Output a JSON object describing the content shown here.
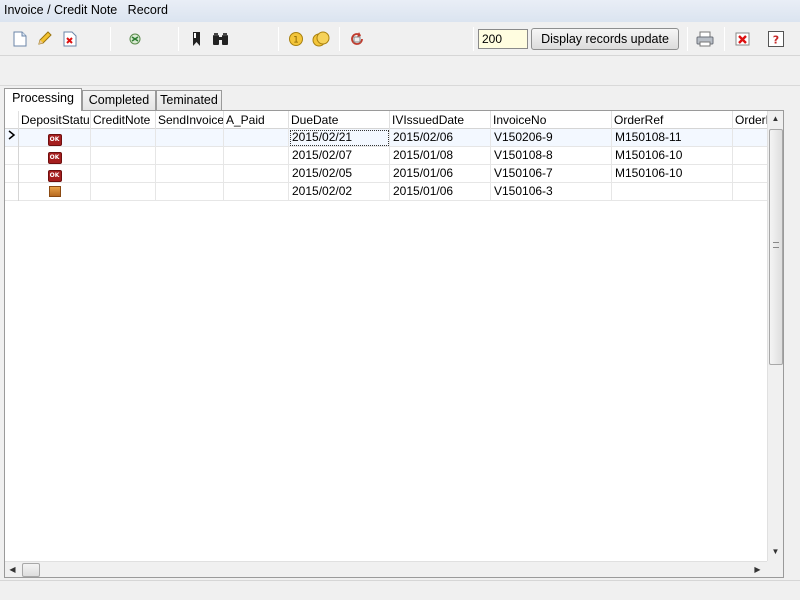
{
  "window": {
    "title": "Invoice / Credit Note   Record"
  },
  "toolbar": {
    "icons": [
      "new-document-icon",
      "edit-pencil-icon",
      "delete-document-icon",
      "excel-export-icon",
      "bookmark-icon",
      "binoculars-icon",
      "coin-icon",
      "coins-icon",
      "refresh-icon",
      "print-icon",
      "close-icon",
      "help-icon"
    ],
    "records_value": "200",
    "update_label": "Display records update"
  },
  "tabs": [
    {
      "label": "Processing",
      "active": true
    },
    {
      "label": "Completed",
      "active": false
    },
    {
      "label": "Teminated",
      "active": false
    }
  ],
  "grid": {
    "columns": [
      "DepositStatus",
      "CreditNote",
      "SendInvoice",
      "A_Paid",
      "DueDate",
      "IVIssuedDate",
      "InvoiceNo",
      "OrderRef",
      "OrderN"
    ],
    "rows": [
      {
        "status_icon": "ok-icon",
        "status_text": "OK",
        "credit_note": "",
        "send_invoice": "",
        "a_paid": "",
        "due_date": "2015/02/21",
        "iv_issued_date": "2015/02/06",
        "invoice_no": "V150206-9",
        "order_ref": "M150108-11",
        "order_n": ""
      },
      {
        "status_icon": "ok-icon",
        "status_text": "OK",
        "credit_note": "",
        "send_invoice": "",
        "a_paid": "",
        "due_date": "2015/02/07",
        "iv_issued_date": "2015/01/08",
        "invoice_no": "V150108-8",
        "order_ref": "M150106-10",
        "order_n": ""
      },
      {
        "status_icon": "ok-icon",
        "status_text": "OK",
        "credit_note": "",
        "send_invoice": "",
        "a_paid": "",
        "due_date": "2015/02/05",
        "iv_issued_date": "2015/01/06",
        "invoice_no": "V150106-7",
        "order_ref": "M150106-10",
        "order_n": ""
      },
      {
        "status_icon": "box-icon",
        "status_text": "",
        "credit_note": "",
        "send_invoice": "",
        "a_paid": "",
        "due_date": "2015/02/02",
        "iv_issued_date": "2015/01/06",
        "invoice_no": "V150106-3",
        "order_ref": "",
        "order_n": ""
      }
    ]
  }
}
